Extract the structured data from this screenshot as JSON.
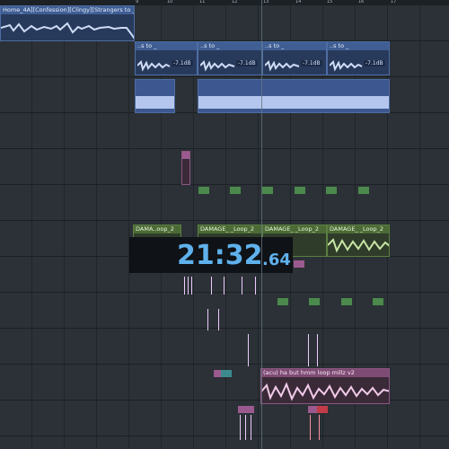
{
  "ruler": {
    "labels": [
      "9",
      "10",
      "11",
      "12",
      "13",
      "14",
      "15",
      "16",
      "17"
    ]
  },
  "timer": {
    "time": "21:32",
    "fraction": ".64"
  },
  "tracks": {
    "top_clip": {
      "label": "Home_4A][Confession][Clingy][Strangers to _"
    },
    "blue_clip_title": "..s to _",
    "gain_label": "-7.1dB",
    "green_clip_title_short": "DAMA..oop_2",
    "green_clip_title": "DAMAGE_ _Loop_2",
    "pink_clip_title": "(acu) ha but hmm loop millz v2"
  },
  "colors": {
    "accent_blue": "#5fb1ec",
    "clip_blue": "#3f5e93",
    "clip_green": "#4b6a36",
    "clip_pink": "#7e4b74"
  }
}
